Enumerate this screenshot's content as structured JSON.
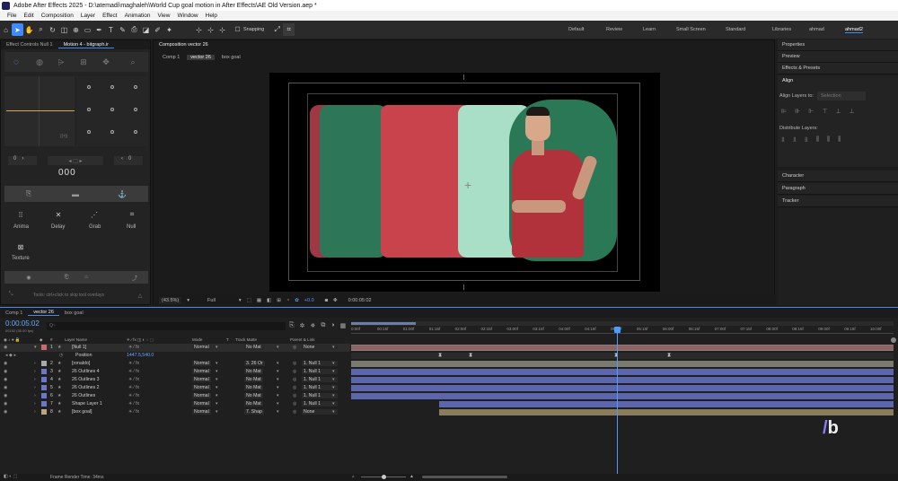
{
  "window_title": "Adobe After Effects 2025 - D:\\atemadi\\maghaleh\\World Cup goal motion in After Effects\\AE Old Version.aep *",
  "menu": [
    "File",
    "Edit",
    "Composition",
    "Layer",
    "Effect",
    "Animation",
    "View",
    "Window",
    "Help"
  ],
  "toolbar": {
    "snapping": "Snapping"
  },
  "workspaces": [
    "Default",
    "Review",
    "Learn",
    "Small Screen",
    "Standard",
    "Libraries",
    "ahmad",
    "ahmad2"
  ],
  "left_panel": {
    "tab1": "Effect Controls Null 1",
    "tab2": "Motion 4 - bitgraph.ir",
    "null_counter_left": "0",
    "null_counter_right": "0",
    "big_counter": "000",
    "buttons": [
      "Anima",
      "Delay",
      "Grab",
      "Null"
    ],
    "texture": "Texture",
    "hint": "Tools: ctrl+click to skip tool overlays"
  },
  "comp_panel": {
    "title": "Composition vector 26",
    "breadcrumbs": [
      "Comp 1",
      "vector 26",
      "box goal"
    ],
    "zoom": "(43.5%)",
    "resolution": "Full",
    "timecode": "0:00:05:02",
    "plus_value": "+0.0"
  },
  "right_panel": {
    "properties": "Properties",
    "preview": "Preview",
    "effects": "Effects & Presets",
    "align": "Align",
    "align_to": "Align Layers to:",
    "align_to_value": "Selection",
    "distribute": "Distribute Layers:",
    "character": "Character",
    "paragraph": "Paragraph",
    "tracker": "Tracker"
  },
  "timeline": {
    "tabs": [
      "Comp 1",
      "vector 26",
      "box goal"
    ],
    "timecode": "0:00:05:02",
    "fps_line": "00152 (30.00 fps)",
    "search_placeholder": "Q~",
    "headers": {
      "hash": "#",
      "layer_name": "Layer Name",
      "mode": "Mode",
      "t": "T",
      "track_matte": "Track Matte",
      "parent": "Parent & Link"
    },
    "position_label": "Position",
    "position_value": "1447.5,540.0",
    "ruler": [
      "0:00f",
      "00:15f",
      "01:00f",
      "01:15f",
      "02:00f",
      "02:15f",
      "03:00f",
      "03:15f",
      "04:00f",
      "04:15f",
      "05:00f",
      "05:15f",
      "06:00f",
      "06:15f",
      "07:00f",
      "07:15f",
      "08:00f",
      "08:15f",
      "09:00f",
      "09:15f",
      "10:00f"
    ],
    "layers": [
      {
        "num": "1",
        "name": "[Null 1]",
        "mode": "Normal",
        "matte": "No Mat",
        "parent": "None",
        "color": "#c86d6d"
      },
      {
        "num": "2",
        "name": "[ronaldo]",
        "mode": "Normal",
        "matte": "3. 26 Or",
        "parent": "1. Null 1",
        "color": "#a9a9a9"
      },
      {
        "num": "3",
        "name": "26 Outlines 4",
        "mode": "Normal",
        "matte": "No Mat",
        "parent": "1. Null 1",
        "color": "#6b78c8"
      },
      {
        "num": "4",
        "name": "26 Outlines 3",
        "mode": "Normal",
        "matte": "No Mat",
        "parent": "1. Null 1",
        "color": "#6b78c8"
      },
      {
        "num": "5",
        "name": "26 Outlines 2",
        "mode": "Normal",
        "matte": "No Mat",
        "parent": "1. Null 1",
        "color": "#6b78c8"
      },
      {
        "num": "6",
        "name": "26 Outlines",
        "mode": "Normal",
        "matte": "No Mat",
        "parent": "1. Null 1",
        "color": "#6b78c8"
      },
      {
        "num": "7",
        "name": "Shape Layer 1",
        "mode": "Normal",
        "matte": "No Mat",
        "parent": "1. Null 1",
        "color": "#6b78c8"
      },
      {
        "num": "8",
        "name": "[box goal]",
        "mode": "Normal",
        "matte": "7. Shap",
        "parent": "None",
        "color": "#bba580"
      }
    ],
    "render_time": "Frame Render Time: 34ms"
  },
  "colors": {
    "accent": "#3d8bff",
    "playhead": "#4a9dff",
    "current_time": "#66aaff"
  }
}
